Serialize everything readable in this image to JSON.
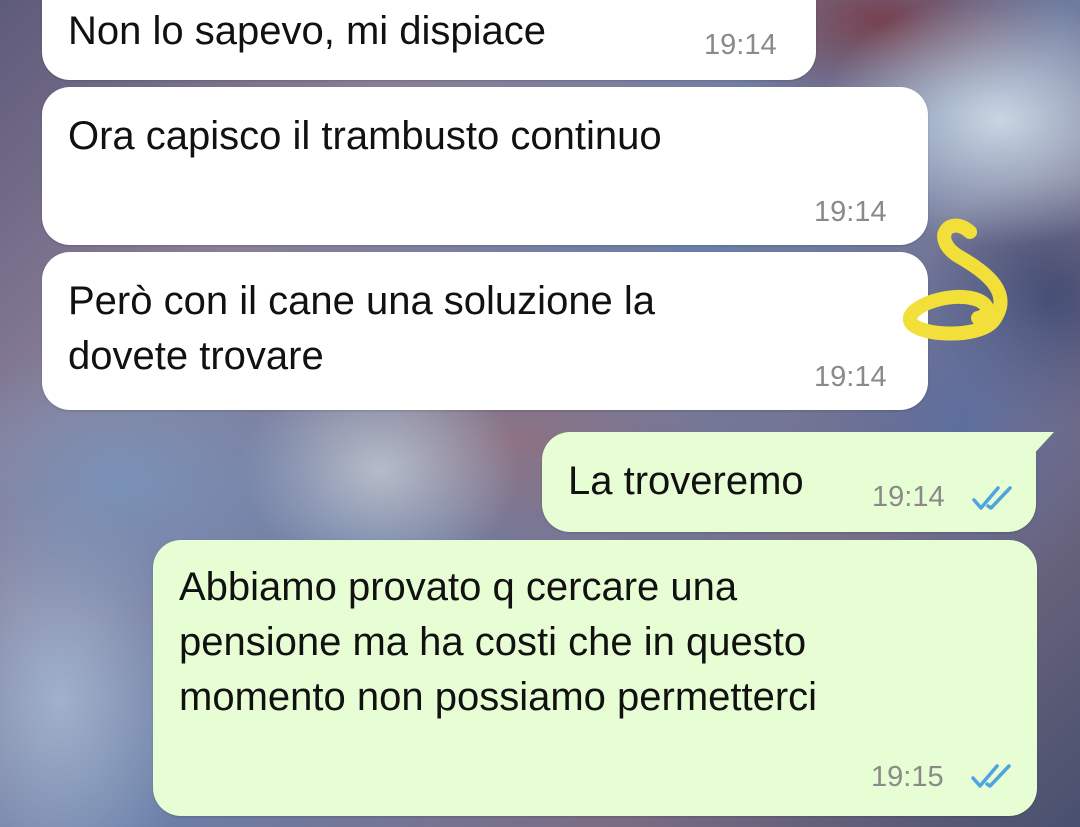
{
  "messages": [
    {
      "text": "Non lo sapevo, mi dispiace",
      "time": "19:14",
      "direction": "incoming"
    },
    {
      "text": "Ora capisco il trambusto continuo",
      "time": "19:14",
      "direction": "incoming"
    },
    {
      "text": "Però con il cane una soluzione la\ndovete trovare",
      "time": "19:14",
      "direction": "incoming"
    },
    {
      "text": "La troveremo",
      "time": "19:14",
      "direction": "outgoing",
      "status": "read"
    },
    {
      "text": "Abbiamo provato q cercare una\npensione ma ha costi che in questo\nmomento non possiamo permetterci",
      "time": "19:15",
      "direction": "outgoing",
      "status": "read"
    }
  ],
  "colors": {
    "incoming_bubble": "#ffffff",
    "outgoing_bubble": "#e7fdd4",
    "read_ticks": "#4fa3e0",
    "doodle": "#f3df3a"
  },
  "icons": {
    "read_receipt": "double-check-icon",
    "annotation": "hand-drawn-8-doodle"
  }
}
